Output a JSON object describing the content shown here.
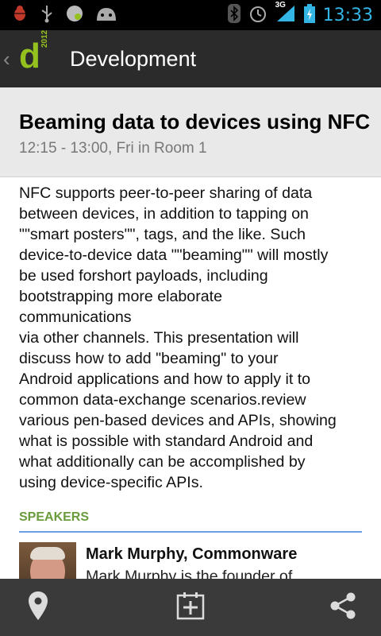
{
  "status_bar": {
    "time": "13:33",
    "network": "3G",
    "icons": [
      "android-bug-icon",
      "usb-icon",
      "app-icon",
      "android-icon",
      "bluetooth-icon",
      "alarm-icon",
      "signal-icon",
      "battery-charging-icon"
    ],
    "accent": "#33b5e5"
  },
  "action_bar": {
    "logo_letter": "d",
    "logo_year": "2012",
    "title": "Development",
    "brand_color": "#95c11f"
  },
  "session": {
    "title": "Beaming data to devices using NFC",
    "subtitle": "12:15 - 13:00, Fri in Room 1"
  },
  "abstract": [
    "NFC supports peer-to-peer sharing of data",
    "between devices, in addition to tapping on",
    "\"\"smart posters\"\", tags, and the like. Such",
    "device-to-device data \"\"beaming\"\" will mostly",
    "be used forshort payloads, including",
    "bootstrapping more elaborate",
    "communications",
    "via other channels. This presentation will",
    "discuss how to add \"beaming\" to your",
    "Android applications and how to apply it to",
    "common data-exchange scenarios.review",
    "various pen-based devices and APIs, showing",
    "what is possible with standard Android and",
    "what additionally can be accomplished by",
    "using device-specific APIs."
  ],
  "speakers": {
    "header": "SPEAKERS",
    "items": [
      {
        "name": "Mark Murphy, Commonware",
        "bio": "Mark Murphy is the founder of"
      }
    ]
  },
  "bottom_bar": {
    "actions": [
      "map-pin-icon",
      "add-to-calendar-icon",
      "share-icon"
    ]
  }
}
